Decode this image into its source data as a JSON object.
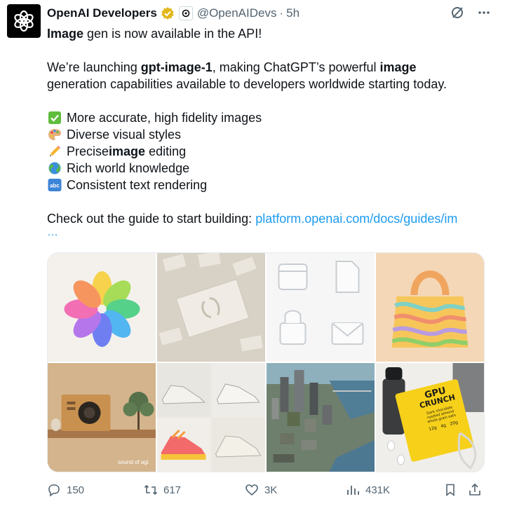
{
  "author": {
    "name": "OpenAI Developers",
    "handle": "@OpenAIDevs",
    "separator": "·",
    "time": "5h"
  },
  "post": {
    "headline_bold": "Image",
    "headline_rest": " gen is now available in the API!",
    "intro_1": "We’re launching ",
    "intro_model": "gpt-image-1",
    "intro_2": ", making ChatGPT’s powerful ",
    "intro_bold": "image",
    "intro_3": "generation capabilities available to developers worldwide starting today.",
    "features": [
      {
        "icon": "check-mark-icon",
        "text": "More accurate, high fidelity images"
      },
      {
        "icon": "artist-palette-icon",
        "text": "Diverse visual styles"
      },
      {
        "icon": "pencil-icon",
        "pre": "Precise ",
        "bold": "image",
        "post": " editing"
      },
      {
        "icon": "globe-icon",
        "text": "Rich world knowledge"
      },
      {
        "icon": "abc-icon",
        "text": "Consistent text rendering"
      }
    ],
    "cta": "Check out the guide to start building: ",
    "link": "platform.openai.com/docs/guides/im",
    "ellipsis": "…"
  },
  "images": {
    "speaker_caption": "sound of agi",
    "bar_title_1": "GPU",
    "bar_title_2": "CRUNCH",
    "bar_desc": "Dark chocolate\nroasted almond\nwhole grain oats",
    "bar_nutrients": [
      "12g",
      "4g",
      "20g"
    ]
  },
  "actions": {
    "replies": "150",
    "reposts": "617",
    "likes": "3K",
    "views": "431K"
  },
  "colors": {
    "link": "#1d9bf0",
    "muted": "#536471",
    "verified": "#e2b719"
  }
}
